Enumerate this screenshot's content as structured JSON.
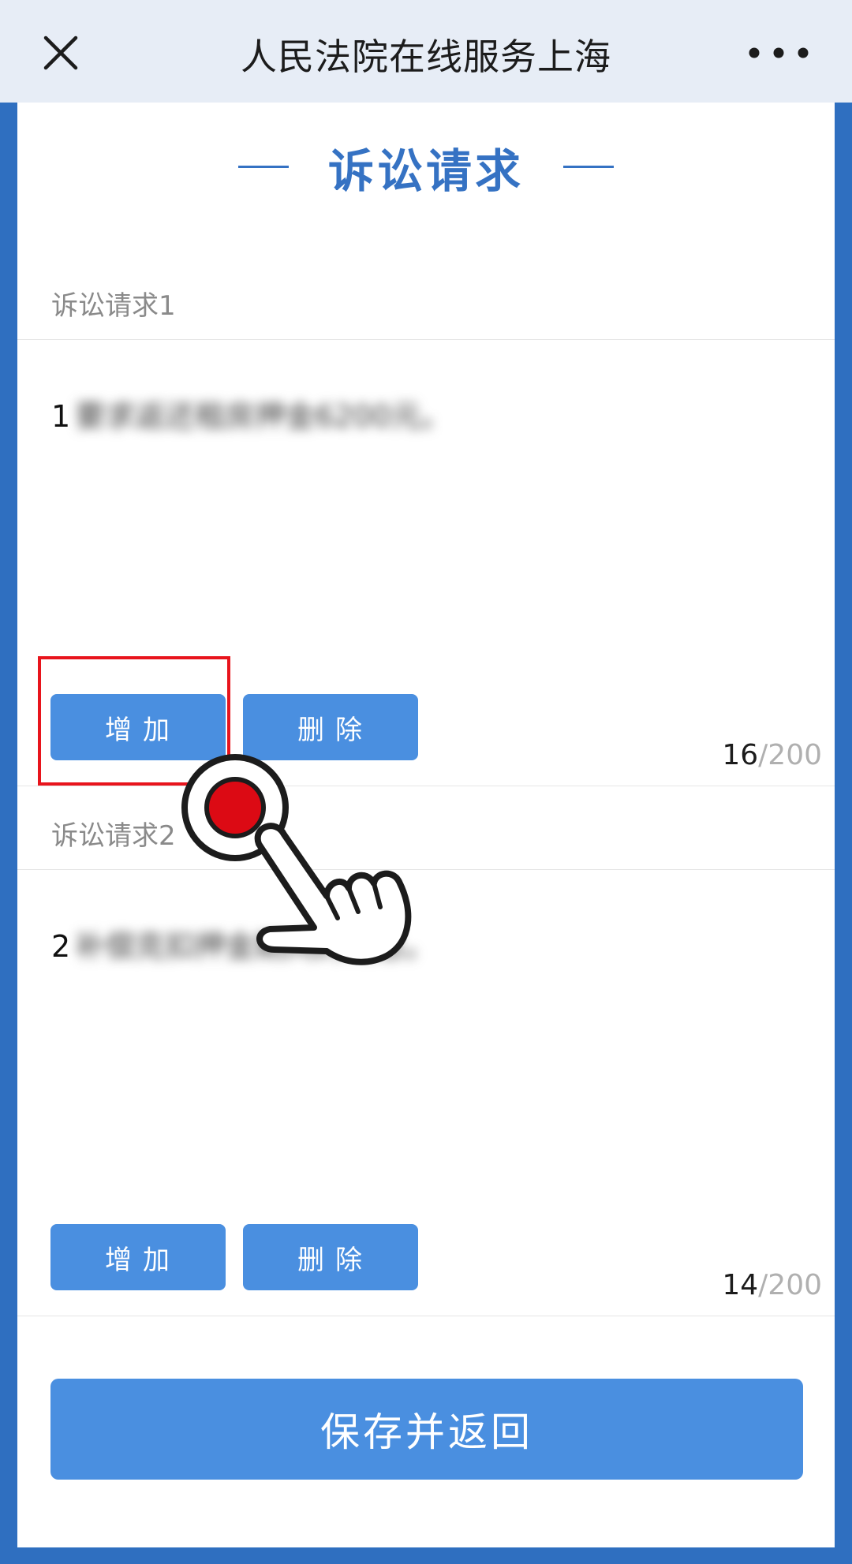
{
  "header": {
    "title": "人民法院在线服务上海"
  },
  "section": {
    "title": "诉讼请求"
  },
  "claims": [
    {
      "label": "诉讼请求1",
      "number": "1",
      "blurred_text": "要求返还租房押金6200元。",
      "count_current": "16",
      "count_max": "/200",
      "add_label": "增加",
      "delete_label": "删除"
    },
    {
      "label": "诉讼请求2",
      "number": "2",
      "blurred_text": "补偿克扣押金期间的利息。",
      "count_current": "14",
      "count_max": "/200",
      "add_label": "增加",
      "delete_label": "删除"
    }
  ],
  "save_label": "保存并返回",
  "colors": {
    "accent": "#4a8fe0",
    "title_blue": "#3572c3",
    "highlight_red": "#e8141c",
    "frame_blue": "#2f6fc0"
  }
}
